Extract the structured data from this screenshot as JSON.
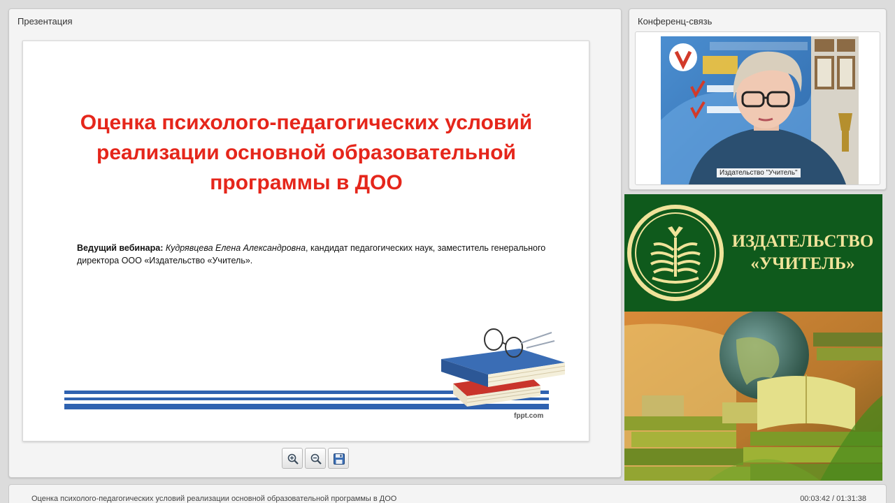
{
  "presentation": {
    "panel_title": "Презентация",
    "slide": {
      "title": "Оценка психолого-педагогических условий реализации основной образовательной программы в ДОО",
      "host_label": "Ведущий вебинара:",
      "host_name": "Кудрявцева Елена Александровна",
      "host_details": ", кандидат педагогических наук, заместитель генерального директора ООО «Издательство «Учитель».",
      "watermark": "fppt.com",
      "title_color": "#e5261b",
      "stripe_color": "#2f62b0"
    },
    "toolbar": {
      "zoom_in_icon": "zoom-in-icon",
      "zoom_out_icon": "zoom-out-icon",
      "save_icon": "floppy-disk-icon"
    }
  },
  "conference": {
    "panel_title": "Конференц-связь",
    "participant_name": "Издательство \"Учитель\""
  },
  "publisher": {
    "name_line1": "ИЗДАТЕЛЬСТВО",
    "name_line2": "«УЧИТЕЛЬ»",
    "brand_green": "#0f5a1c",
    "brand_gold": "#f0e39a"
  },
  "footer": {
    "webinar_title": "Оценка психолого-педагогических условий реализации основной образовательной программы в ДОО",
    "time": "00:03:42 / 01:31:38"
  }
}
